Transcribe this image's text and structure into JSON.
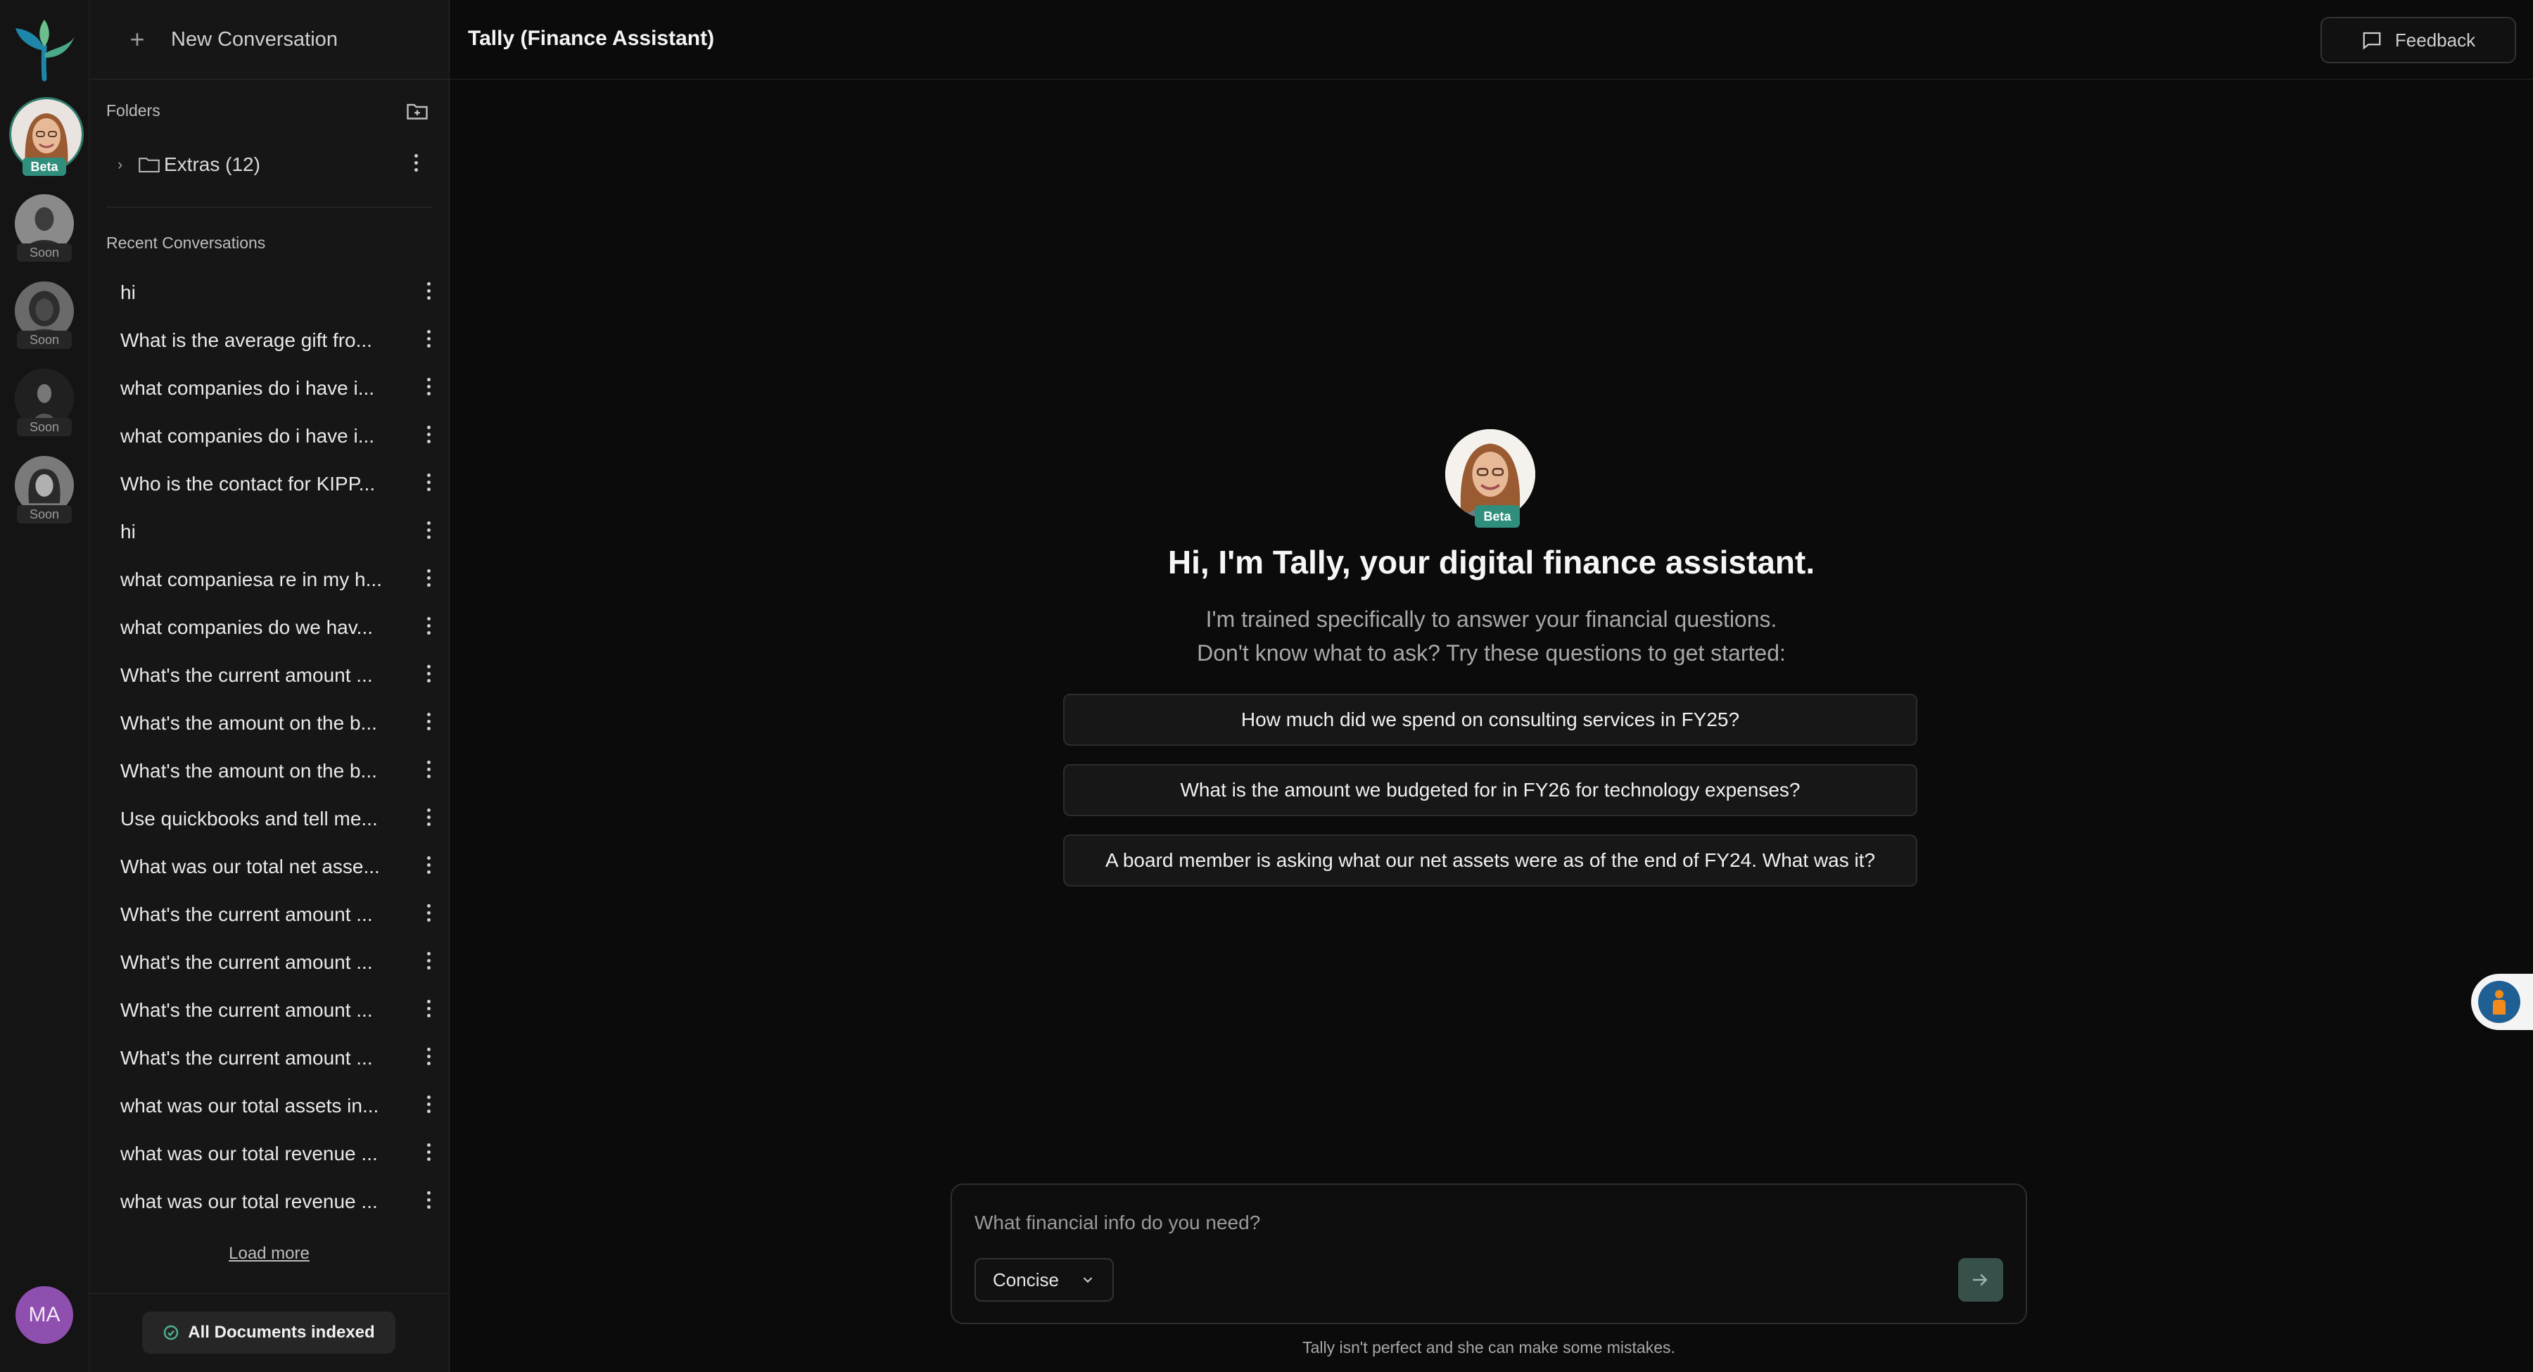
{
  "app": {
    "title": "Tally (Finance Assistant)",
    "feedback_label": "Feedback",
    "colors": {
      "accent": "#2f8f7c",
      "background": "#0b0b0b",
      "sidebar": "#161616",
      "user_avatar": "#8e4fae"
    }
  },
  "rail": {
    "agents": [
      {
        "badge": "Beta",
        "state": "active"
      },
      {
        "badge": "Soon",
        "state": "disabled"
      },
      {
        "badge": "Soon",
        "state": "disabled"
      },
      {
        "badge": "Soon",
        "state": "disabled"
      },
      {
        "badge": "Soon",
        "state": "disabled"
      }
    ],
    "user_initials": "MA"
  },
  "sidebar": {
    "new_conversation_label": "New Conversation",
    "folders_title": "Folders",
    "folders": [
      {
        "label": "Extras (12)"
      }
    ],
    "recent_title": "Recent Conversations",
    "conversations": [
      {
        "label": "hi"
      },
      {
        "label": "What is the average gift fro..."
      },
      {
        "label": "what companies do i have i..."
      },
      {
        "label": "what companies do i have i..."
      },
      {
        "label": "Who is the contact for KIPP..."
      },
      {
        "label": "hi"
      },
      {
        "label": "what companiesa re in my h..."
      },
      {
        "label": "what companies do we hav..."
      },
      {
        "label": "What's the current amount ..."
      },
      {
        "label": "What's the amount on the b..."
      },
      {
        "label": "What's the amount on the b..."
      },
      {
        "label": "Use quickbooks and tell me..."
      },
      {
        "label": "What was our total net asse..."
      },
      {
        "label": "What's the current amount ..."
      },
      {
        "label": "What's the current amount ..."
      },
      {
        "label": "What's the current amount ..."
      },
      {
        "label": "What's the current amount ..."
      },
      {
        "label": "what was our total assets in..."
      },
      {
        "label": "what was our total revenue ..."
      },
      {
        "label": "what was our total revenue ..."
      }
    ],
    "load_more_label": "Load more",
    "indexed_status": "All Documents indexed"
  },
  "main": {
    "badge": "Beta",
    "greeting": "Hi, I'm Tally, your digital finance assistant.",
    "subtitle_line1": "I'm trained specifically to answer your financial questions.",
    "subtitle_line2": "Don't know what to ask? Try these questions to get started:",
    "suggestions": [
      {
        "label": "How much did we spend on consulting services in FY25?"
      },
      {
        "label": "What is the amount we budgeted for in FY26 for technology expenses?"
      },
      {
        "label": "A board member is asking what our net assets were as of the end of FY24. What was it?"
      }
    ],
    "composer": {
      "placeholder": "What financial info do you need?",
      "mode": "Concise"
    },
    "disclaimer": "Tally isn't perfect and she can make some mistakes."
  }
}
